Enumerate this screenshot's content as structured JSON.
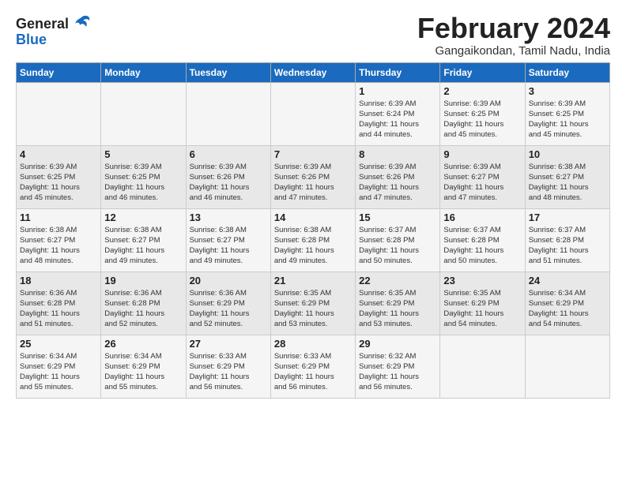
{
  "header": {
    "logo_general": "General",
    "logo_blue": "Blue",
    "title": "February 2024",
    "subtitle": "Gangaikondan, Tamil Nadu, India"
  },
  "days_of_week": [
    "Sunday",
    "Monday",
    "Tuesday",
    "Wednesday",
    "Thursday",
    "Friday",
    "Saturday"
  ],
  "weeks": [
    [
      {
        "num": "",
        "info": ""
      },
      {
        "num": "",
        "info": ""
      },
      {
        "num": "",
        "info": ""
      },
      {
        "num": "",
        "info": ""
      },
      {
        "num": "1",
        "info": "Sunrise: 6:39 AM\nSunset: 6:24 PM\nDaylight: 11 hours\nand 44 minutes."
      },
      {
        "num": "2",
        "info": "Sunrise: 6:39 AM\nSunset: 6:25 PM\nDaylight: 11 hours\nand 45 minutes."
      },
      {
        "num": "3",
        "info": "Sunrise: 6:39 AM\nSunset: 6:25 PM\nDaylight: 11 hours\nand 45 minutes."
      }
    ],
    [
      {
        "num": "4",
        "info": "Sunrise: 6:39 AM\nSunset: 6:25 PM\nDaylight: 11 hours\nand 45 minutes."
      },
      {
        "num": "5",
        "info": "Sunrise: 6:39 AM\nSunset: 6:25 PM\nDaylight: 11 hours\nand 46 minutes."
      },
      {
        "num": "6",
        "info": "Sunrise: 6:39 AM\nSunset: 6:26 PM\nDaylight: 11 hours\nand 46 minutes."
      },
      {
        "num": "7",
        "info": "Sunrise: 6:39 AM\nSunset: 6:26 PM\nDaylight: 11 hours\nand 47 minutes."
      },
      {
        "num": "8",
        "info": "Sunrise: 6:39 AM\nSunset: 6:26 PM\nDaylight: 11 hours\nand 47 minutes."
      },
      {
        "num": "9",
        "info": "Sunrise: 6:39 AM\nSunset: 6:27 PM\nDaylight: 11 hours\nand 47 minutes."
      },
      {
        "num": "10",
        "info": "Sunrise: 6:38 AM\nSunset: 6:27 PM\nDaylight: 11 hours\nand 48 minutes."
      }
    ],
    [
      {
        "num": "11",
        "info": "Sunrise: 6:38 AM\nSunset: 6:27 PM\nDaylight: 11 hours\nand 48 minutes."
      },
      {
        "num": "12",
        "info": "Sunrise: 6:38 AM\nSunset: 6:27 PM\nDaylight: 11 hours\nand 49 minutes."
      },
      {
        "num": "13",
        "info": "Sunrise: 6:38 AM\nSunset: 6:27 PM\nDaylight: 11 hours\nand 49 minutes."
      },
      {
        "num": "14",
        "info": "Sunrise: 6:38 AM\nSunset: 6:28 PM\nDaylight: 11 hours\nand 49 minutes."
      },
      {
        "num": "15",
        "info": "Sunrise: 6:37 AM\nSunset: 6:28 PM\nDaylight: 11 hours\nand 50 minutes."
      },
      {
        "num": "16",
        "info": "Sunrise: 6:37 AM\nSunset: 6:28 PM\nDaylight: 11 hours\nand 50 minutes."
      },
      {
        "num": "17",
        "info": "Sunrise: 6:37 AM\nSunset: 6:28 PM\nDaylight: 11 hours\nand 51 minutes."
      }
    ],
    [
      {
        "num": "18",
        "info": "Sunrise: 6:36 AM\nSunset: 6:28 PM\nDaylight: 11 hours\nand 51 minutes."
      },
      {
        "num": "19",
        "info": "Sunrise: 6:36 AM\nSunset: 6:28 PM\nDaylight: 11 hours\nand 52 minutes."
      },
      {
        "num": "20",
        "info": "Sunrise: 6:36 AM\nSunset: 6:29 PM\nDaylight: 11 hours\nand 52 minutes."
      },
      {
        "num": "21",
        "info": "Sunrise: 6:35 AM\nSunset: 6:29 PM\nDaylight: 11 hours\nand 53 minutes."
      },
      {
        "num": "22",
        "info": "Sunrise: 6:35 AM\nSunset: 6:29 PM\nDaylight: 11 hours\nand 53 minutes."
      },
      {
        "num": "23",
        "info": "Sunrise: 6:35 AM\nSunset: 6:29 PM\nDaylight: 11 hours\nand 54 minutes."
      },
      {
        "num": "24",
        "info": "Sunrise: 6:34 AM\nSunset: 6:29 PM\nDaylight: 11 hours\nand 54 minutes."
      }
    ],
    [
      {
        "num": "25",
        "info": "Sunrise: 6:34 AM\nSunset: 6:29 PM\nDaylight: 11 hours\nand 55 minutes."
      },
      {
        "num": "26",
        "info": "Sunrise: 6:34 AM\nSunset: 6:29 PM\nDaylight: 11 hours\nand 55 minutes."
      },
      {
        "num": "27",
        "info": "Sunrise: 6:33 AM\nSunset: 6:29 PM\nDaylight: 11 hours\nand 56 minutes."
      },
      {
        "num": "28",
        "info": "Sunrise: 6:33 AM\nSunset: 6:29 PM\nDaylight: 11 hours\nand 56 minutes."
      },
      {
        "num": "29",
        "info": "Sunrise: 6:32 AM\nSunset: 6:29 PM\nDaylight: 11 hours\nand 56 minutes."
      },
      {
        "num": "",
        "info": ""
      },
      {
        "num": "",
        "info": ""
      }
    ]
  ]
}
